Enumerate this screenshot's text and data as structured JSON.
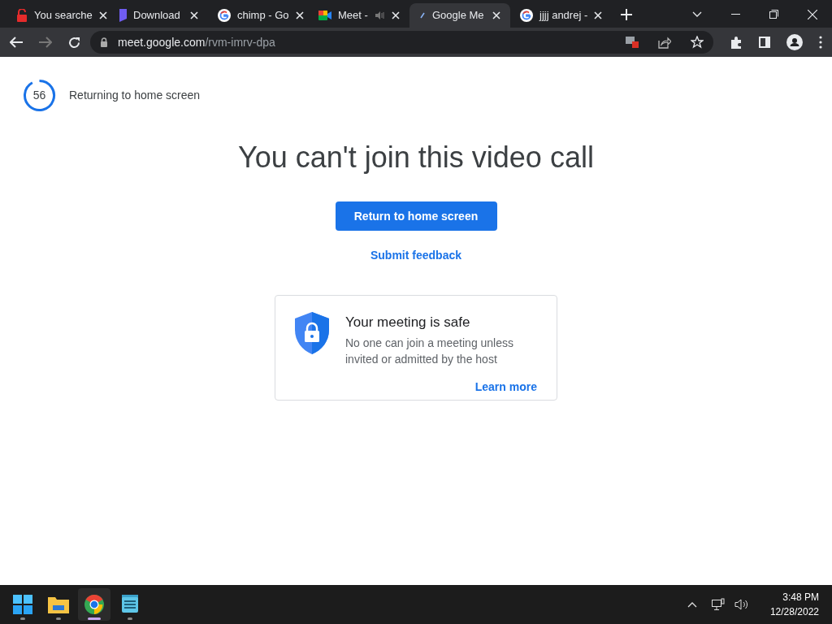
{
  "tabs": [
    {
      "title": "You searche",
      "kind": "lock",
      "selected": false,
      "audio": false
    },
    {
      "title": "Download",
      "kind": "doc",
      "selected": false,
      "audio": false
    },
    {
      "title": "chimp - Go",
      "kind": "google",
      "selected": false,
      "audio": false
    },
    {
      "title": "Meet -",
      "kind": "meet",
      "selected": false,
      "audio": true
    },
    {
      "title": "Google Me",
      "kind": "loading",
      "selected": true,
      "audio": false
    },
    {
      "title": "jjjj andrej -",
      "kind": "google",
      "selected": false,
      "audio": false
    }
  ],
  "address": {
    "host": "meet.google.com",
    "path": "/rvm-imrv-dpa"
  },
  "countdown": {
    "number": "56",
    "level": 0.92,
    "label": "Returning to home screen"
  },
  "heading": "You can't join this video call",
  "primary_button": "Return to home screen",
  "feedback_link": "Submit feedback",
  "info_card": {
    "title": "Your meeting is safe",
    "body": "No one can join a meeting unless invited or admitted by the host",
    "link": "Learn more"
  },
  "taskbar": {
    "apps": [
      {
        "kind": "start",
        "running": false
      },
      {
        "kind": "folder",
        "running": false
      },
      {
        "kind": "chrome",
        "running": true
      },
      {
        "kind": "notepad",
        "running": false
      }
    ],
    "time": "3:48 PM",
    "date": "12/28/2022"
  }
}
